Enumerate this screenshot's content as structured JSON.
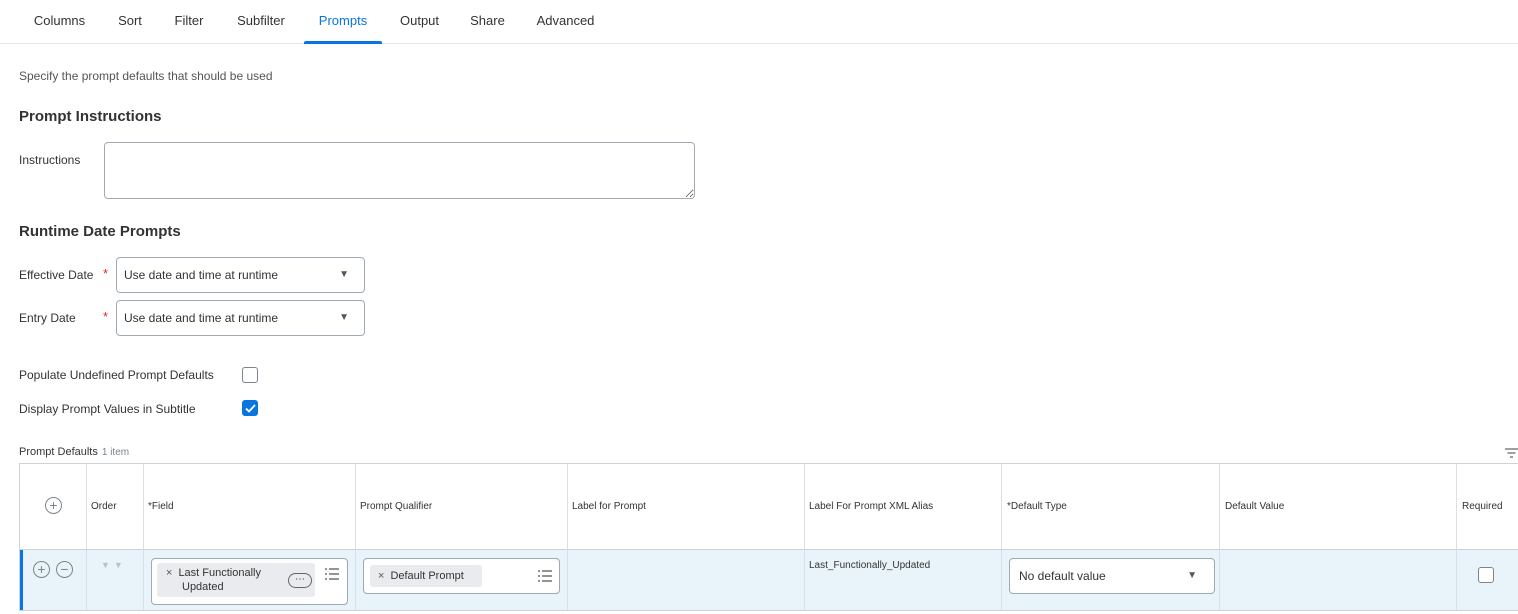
{
  "tabs": [
    {
      "label": "Columns"
    },
    {
      "label": "Sort"
    },
    {
      "label": "Filter"
    },
    {
      "label": "Subfilter"
    },
    {
      "label": "Prompts",
      "active": true
    },
    {
      "label": "Output"
    },
    {
      "label": "Share"
    },
    {
      "label": "Advanced"
    }
  ],
  "intro": "Specify the prompt defaults that should be used",
  "prompt_instructions": {
    "heading": "Prompt Instructions",
    "instructions_label": "Instructions",
    "instructions_value": ""
  },
  "runtime": {
    "heading": "Runtime Date Prompts",
    "effective_date_label": "Effective Date",
    "effective_date_value": "Use date and time at runtime",
    "entry_date_label": "Entry Date",
    "entry_date_value": "Use date and time at runtime",
    "required_marker": "*"
  },
  "options": {
    "populate_label": "Populate Undefined Prompt Defaults",
    "populate_checked": false,
    "display_label": "Display Prompt Values in Subtitle",
    "display_checked": true
  },
  "prompt_defaults": {
    "title": "Prompt Defaults",
    "count": "1 item",
    "columns": [
      "Order",
      "*Field",
      "Prompt Qualifier",
      "Label for Prompt",
      "Label For Prompt XML Alias",
      "*Default Type",
      "Default Value",
      "Required"
    ],
    "row": {
      "field_line1": "Last Functionally",
      "field_line2": "Updated",
      "field_more": "⋯",
      "qualifier": "Default Prompt",
      "label_for_prompt": "",
      "xml_alias": "Last_Functionally_Updated",
      "default_type": "No default value",
      "default_value": "",
      "required": false
    }
  },
  "colors": {
    "accent": "#0875e1",
    "row_highlight": "#e8f4fa",
    "required": "#de2e21"
  },
  "icons": {
    "remove": "×",
    "add": "+",
    "minus": "−",
    "caret": "▼"
  }
}
